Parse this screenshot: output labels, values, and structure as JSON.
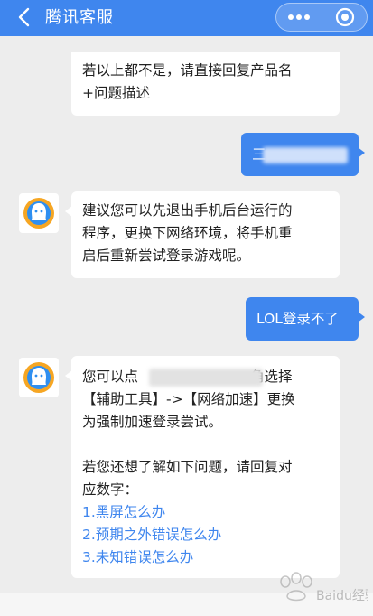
{
  "header": {
    "title": "腾讯客服",
    "back_icon": "chevron-left-icon",
    "more_icon": "more-dots-icon",
    "close_icon": "target-close-icon",
    "bar_color": "#3f86ee"
  },
  "messages": {
    "m1": {
      "sender": "service",
      "lines": [
        "若以上都不是，请直接回复产品名",
        "+问题描述"
      ]
    },
    "m2": {
      "sender": "user",
      "text": "三"
    },
    "m3": {
      "sender": "service",
      "lines": [
        "建议您可以先退出手机后台运行的",
        "程序，更换下网络环境，将手机重",
        "启后重新尝试登录游戏呢。"
      ]
    },
    "m4": {
      "sender": "user",
      "text": "LOL登录不了"
    },
    "m5": {
      "sender": "service",
      "line1_start": "您可以点",
      "line1_end": "角选择",
      "lines": [
        "【辅助工具】->【网络加速】更换",
        "为强制加速登录尝试。"
      ],
      "prompt_lines": [
        "若您还想了解如下问题，请回复对",
        "应数字："
      ],
      "options": [
        "1.黑屏怎么办",
        "2.预期之外错误怎么办",
        "3.未知错误怎么办"
      ]
    }
  },
  "watermark": {
    "text": "Baidu经验"
  },
  "colors": {
    "accent": "#3f86ee",
    "background": "#ededed",
    "bubble": "#ffffff"
  }
}
